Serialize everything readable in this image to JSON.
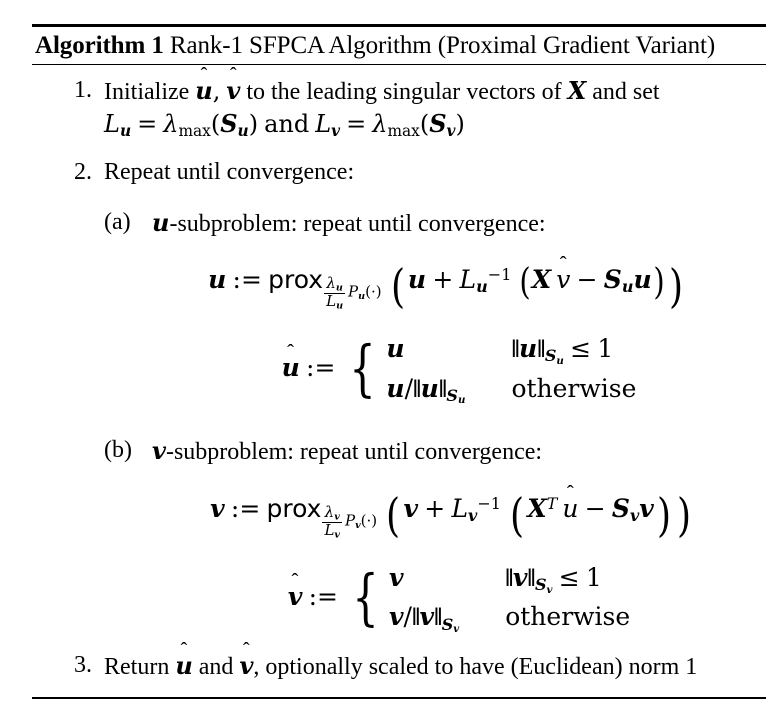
{
  "document": {
    "type": "algorithm-block",
    "background_color": "#ffffff",
    "text_color": "#000000"
  },
  "algorithm": {
    "label": "Algorithm 1",
    "title": "Rank-1 SFPCA Algorithm (Proximal Gradient Variant)",
    "steps": [
      {
        "number": "1.",
        "text_line_1": "Initialize û, v̂ to the leading singular vectors of X and set",
        "text_line_2": "L_u = λ_max(S_u) and L_v = λ_max(S_v)"
      },
      {
        "number": "2.",
        "text": "Repeat until convergence:",
        "substeps": [
          {
            "marker": "(a)",
            "heading": "u-subproblem: repeat until convergence:",
            "update_equation": "u := prox_{(λ_u/L_u) P_u(·)} (u + L_u^{-1} (X v̂ − S_u u))",
            "cases_lhs": "û :=",
            "cases": [
              {
                "value": "u",
                "condition": "‖u‖_{S_u} ≤ 1"
              },
              {
                "value": "u/‖u‖_{S_u}",
                "condition": "otherwise"
              }
            ]
          },
          {
            "marker": "(b)",
            "heading": "v-subproblem: repeat until convergence:",
            "update_equation": "v := prox_{(λ_v/L_v) P_v(·)} (v + L_v^{-1} (X^T û − S_v v))",
            "cases_lhs": "v̂ :=",
            "cases": [
              {
                "value": "v",
                "condition": "‖v‖_{S_v} ≤ 1"
              },
              {
                "value": "v/‖v‖_{S_v}",
                "condition": "otherwise"
              }
            ]
          }
        ]
      },
      {
        "number": "3.",
        "text": "Return û and v̂, optionally scaled to have (Euclidean) norm 1"
      }
    ],
    "symbols": {
      "prox": "prox",
      "lambda": "λ",
      "lambda_max": "λ",
      "max_sub": "max",
      "assign": ":=",
      "leq": "≤",
      "one": "1",
      "otherwise": "otherwise",
      "and": "and",
      "hat": "ˆ",
      "minus": "−",
      "plus": "+",
      "cdot": "·",
      "transpose": "T",
      "inverse": "−1"
    },
    "step1_parts": {
      "initialize": "Initialize",
      "to_the_leading": " to the leading singular vectors of ",
      "and_set": " and set"
    },
    "step3_parts": {
      "return": "Return",
      "and": " and ",
      "tail": ", optionally scaled to have (Euclidean) norm 1"
    },
    "subproblem_suffix": "-subproblem: repeat until convergence:"
  }
}
